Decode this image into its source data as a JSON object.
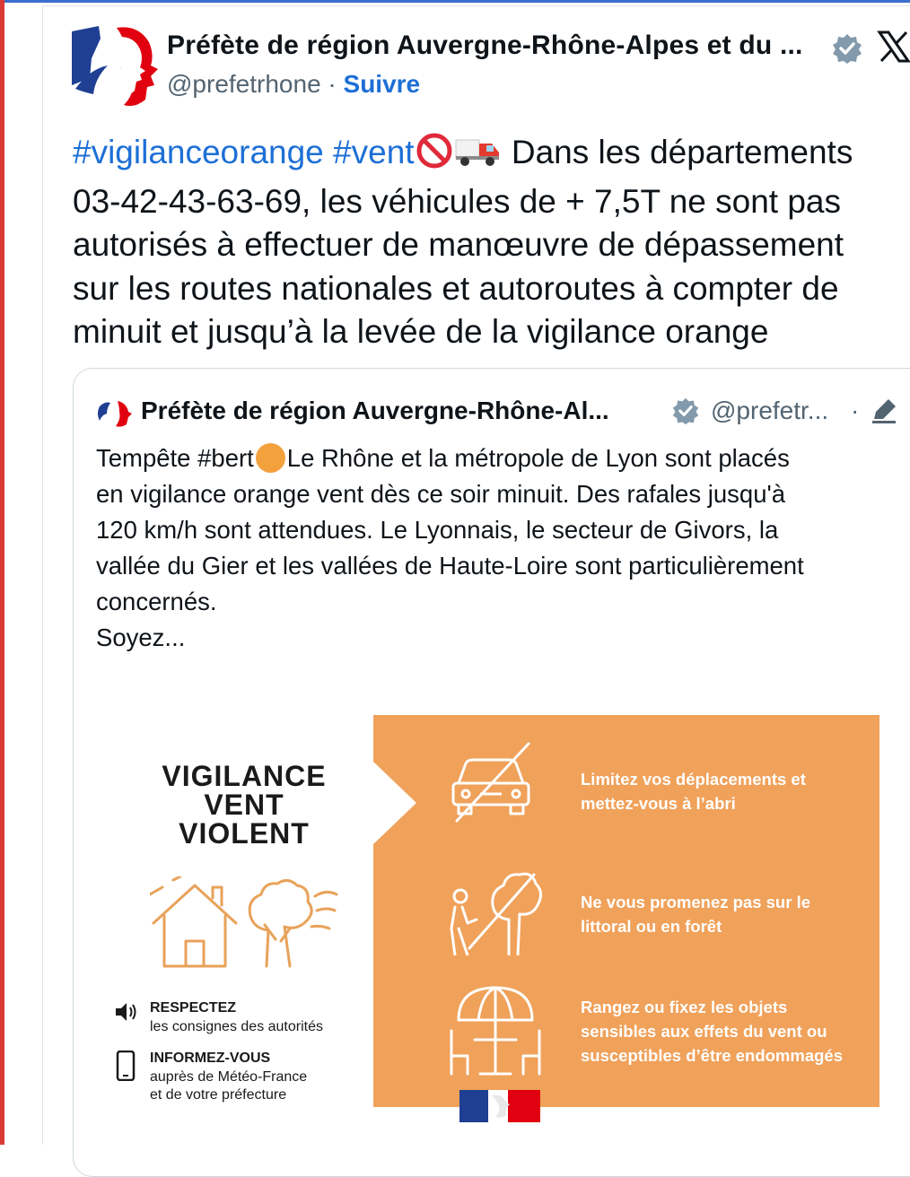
{
  "author": {
    "name": "Préfète de région Auvergne-Rhône-Alpes et du ...",
    "handle": "@prefetrhone",
    "separator": "·",
    "follow_label": "Suivre",
    "verified_icon": "verified-badge-icon",
    "platform_icon": "x-logo-icon"
  },
  "tweet": {
    "hashtag1": "#vigilanceorange",
    "hashtag2": "#vent",
    "text": " Dans les départements\n03-42-43-63-69, les véhicules de + 7,5T ne sont pas\nautorisés à effectuer de manœuvre de dépassement\nsur les routes nationales et autoroutes à compter de\nminuit et jusqu’à la levée de la vigilance orange",
    "emojis": [
      "no-entry-emoji",
      "truck-emoji"
    ]
  },
  "quote": {
    "name": "Préfète de région Auvergne-Rhône-Al...",
    "handle": "@prefetr...",
    "separator": "·",
    "text_before": "Tempête #bert",
    "text_after": "Le Rhône et la métropole de Lyon sont placés\nen vigilance orange vent dès ce soir minuit.  Des rafales jusqu'à\n120 km/h sont attendues.  Le  Lyonnais, le secteur de Givors, la\nvallée du Gier et les vallées de Haute-Loire sont particulièrement\nconcernés.\nSoyez..."
  },
  "infographic": {
    "title_line1": "VIGILANCE",
    "title_line2": "VENT",
    "title_line3": "VIOLENT",
    "advice": [
      {
        "head": "RESPECTEZ",
        "body": "les consignes des autorités",
        "icon": "speaker-icon"
      },
      {
        "head": "INFORMEZ-VOUS",
        "body": "auprès de Météo-France\net de votre préfecture",
        "icon": "phone-icon"
      }
    ],
    "tips": [
      {
        "text": "Limitez vos déplacements et\nmettez-vous à l’abri",
        "icon": "crossed-car-icon"
      },
      {
        "text": "Ne vous promenez pas sur le\nlittoral ou en forêt",
        "icon": "crossed-walker-tree-icon"
      },
      {
        "text": "Rangez ou fixez les objets\nsensibles aux effets du vent ou\nsusceptibles d’être endommagés",
        "icon": "parasol-table-icon"
      }
    ],
    "colors": {
      "panel": "#f0a15a",
      "illustration": "#e8a25a"
    }
  },
  "colors": {
    "link": "#1d6fd6",
    "muted": "#536471",
    "accent_left": "#d93a35",
    "top_line": "#3b6fcf"
  }
}
